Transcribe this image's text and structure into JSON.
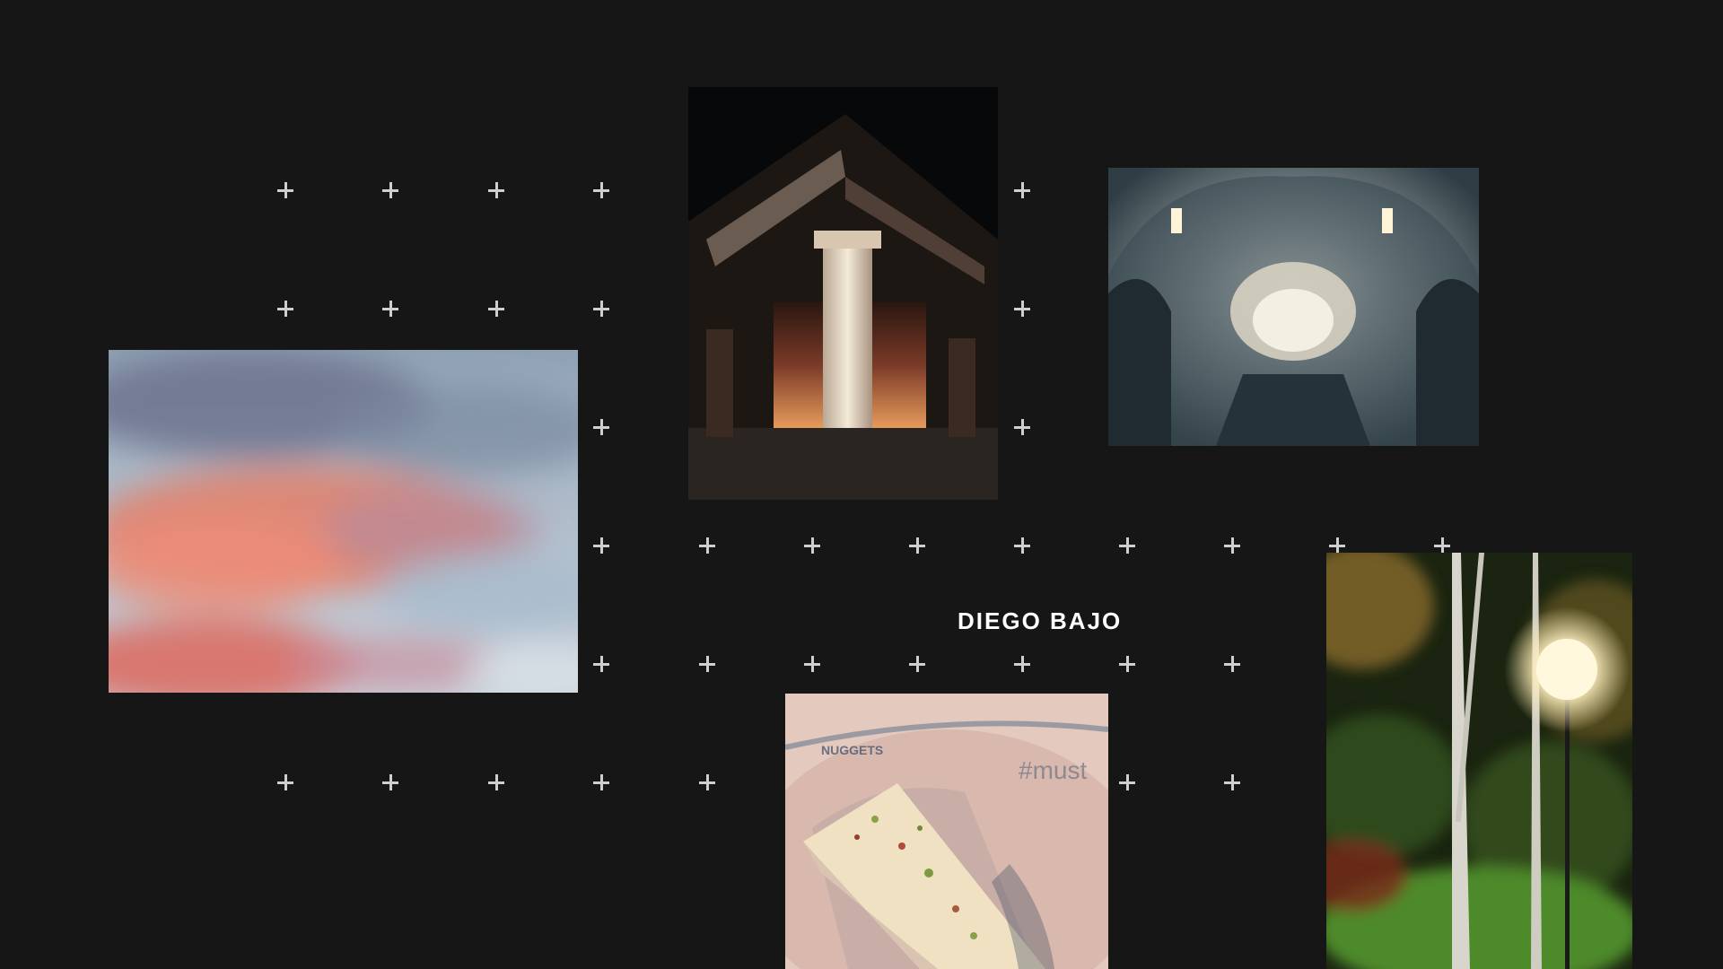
{
  "site": {
    "title": "DIEGO BAJO"
  },
  "gallery": {
    "photos": [
      {
        "name": "clouds",
        "subject": "pink sunset clouds"
      },
      {
        "name": "building",
        "subject": "illuminated building corner at night"
      },
      {
        "name": "interior",
        "subject": "church ceiling interior"
      },
      {
        "name": "cake",
        "subject": "slice of pistachio cake on paper"
      },
      {
        "name": "forest",
        "subject": "birch trees with street lamp at night"
      }
    ]
  },
  "colors": {
    "background": "#161617",
    "plus": "#cfcfcf",
    "title": "#ffffff"
  },
  "icons": {
    "grid_marker": "plus-icon"
  }
}
